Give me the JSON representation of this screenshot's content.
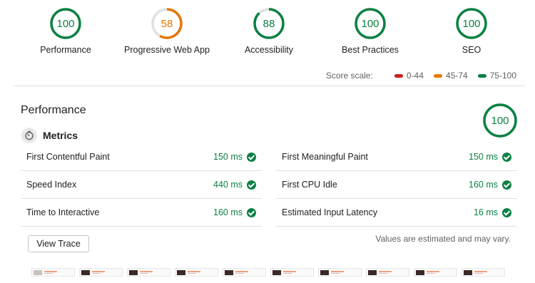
{
  "colors": {
    "pass": "#0b8043",
    "average": "#e67700",
    "fail": "#c7221f",
    "track_pass": "#e0e0e0"
  },
  "gauges": [
    {
      "label": "Performance",
      "score": "100",
      "fraction": 1.0,
      "color": "#0b8043"
    },
    {
      "label": "Progressive Web App",
      "score": "58",
      "fraction": 0.58,
      "color": "#e67700"
    },
    {
      "label": "Accessibility",
      "score": "88",
      "fraction": 0.88,
      "color": "#0b8043"
    },
    {
      "label": "Best Practices",
      "score": "100",
      "fraction": 1.0,
      "color": "#0b8043"
    },
    {
      "label": "SEO",
      "score": "100",
      "fraction": 1.0,
      "color": "#0b8043"
    }
  ],
  "scale": {
    "label": "Score scale:",
    "items": [
      {
        "range": "0-44",
        "color": "#c7221f"
      },
      {
        "range": "45-74",
        "color": "#e67700"
      },
      {
        "range": "75-100",
        "color": "#0b8043"
      }
    ]
  },
  "performance": {
    "title": "Performance",
    "score": "100",
    "fraction": 1.0,
    "metrics_title": "Metrics",
    "metrics_icon": "stopwatch-icon",
    "left_metrics": [
      {
        "name": "First Contentful Paint",
        "value": "150 ms"
      },
      {
        "name": "Speed Index",
        "value": "440 ms"
      },
      {
        "name": "Time to Interactive",
        "value": "160 ms"
      }
    ],
    "right_metrics": [
      {
        "name": "First Meaningful Paint",
        "value": "150 ms"
      },
      {
        "name": "First CPU Idle",
        "value": "160 ms"
      },
      {
        "name": "Estimated Input Latency",
        "value": "16 ms"
      }
    ],
    "view_trace": "View Trace",
    "disclaimer": "Values are estimated and may vary."
  },
  "filmstrip_frames": 10
}
